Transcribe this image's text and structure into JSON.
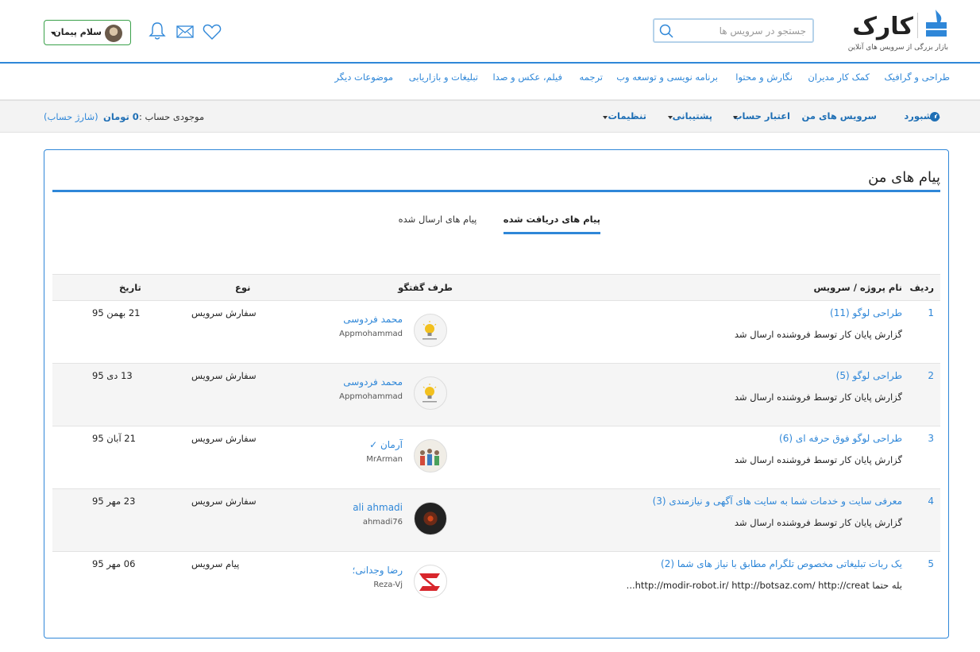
{
  "header": {
    "logo_text": "کارک",
    "logo_sub": "بازار بزرگی از سرویس های آنلاین",
    "search_placeholder": "جستجو در سرویس ها",
    "user_greeting": "سلام پیمان"
  },
  "category_nav": [
    "طراحی و گرافیک",
    "کمک کار مدیران",
    "نگارش و محتوا",
    "برنامه نویسی و توسعه وب",
    "ترجمه",
    "فیلم، عکس و صدا",
    "تبلیغات و بازاریابی",
    "موضوعات دیگر"
  ],
  "account_bar": {
    "dashboard": "داشبورد",
    "my_services": "سرویس های من",
    "account_credit": "اعتبار حساب",
    "support": "پشتیبانی",
    "settings": "تنظیمات",
    "balance_label": "موجودی حساب :",
    "balance_value": "0 تومان",
    "charge_link": "(شارژ حساب)"
  },
  "panel": {
    "title": "پیام های من",
    "tabs": [
      "پیام های دریافت شده",
      "پیام های ارسال شده"
    ],
    "active_tab": 0,
    "columns": {
      "row": "ردیف",
      "project": "نام پروژه / سرویس",
      "party": "طرف گفتگو",
      "type": "نوع",
      "date": "تاریخ"
    },
    "rows": [
      {
        "num": "1",
        "title": "طراحی لوگو (11)",
        "subtitle": "گزارش پایان کار توسط فروشنده ارسال شد",
        "name": "محمد فردوسی",
        "username": "Appmohammad",
        "avatar": "bulb-avatar",
        "type": "سفارش سرویس",
        "date": "21 بهمن 95"
      },
      {
        "num": "2",
        "title": "طراحی لوگو (5)",
        "subtitle": "گزارش پایان کار توسط فروشنده ارسال شد",
        "name": "محمد فردوسی",
        "username": "Appmohammad",
        "avatar": "bulb-avatar",
        "type": "سفارش سرویس",
        "date": "13 دی 95"
      },
      {
        "num": "3",
        "title": "طراحی لوگو فوق حرفه ای (6)",
        "subtitle": "گزارش پایان کار توسط فروشنده ارسال شد",
        "name": "آرمان ✓",
        "username": "MrArman",
        "avatar": "family-avatar",
        "type": "سفارش سرویس",
        "date": "21 آبان 95"
      },
      {
        "num": "4",
        "title": "معرفی سایت و خدمات شما به سایت های آگهی و نیازمندی (3)",
        "subtitle": "گزارش پایان کار توسط فروشنده ارسال شد",
        "name": "ali ahmadi",
        "username": "ahmadi76",
        "avatar": "dark-avatar",
        "type": "سفارش سرویس",
        "date": "23 مهر 95"
      },
      {
        "num": "5",
        "title": "یک ربات تبلیغاتی مخصوص تلگرام مطابق با نیاز های شما (2)",
        "subtitle": "بله حتما http://modir-robot.ir/ http://botsaz.com/ http://creat...",
        "name": "رضا وجدانی؛",
        "username": "Reza-Vj",
        "avatar": "red-logo-avatar",
        "type": "پیام سرویس",
        "date": "06 مهر 95"
      }
    ]
  },
  "colors": {
    "accent": "#2f87d8",
    "user_button_border": "#3aa14a",
    "row_alt_bg": "#f5f5f5"
  }
}
